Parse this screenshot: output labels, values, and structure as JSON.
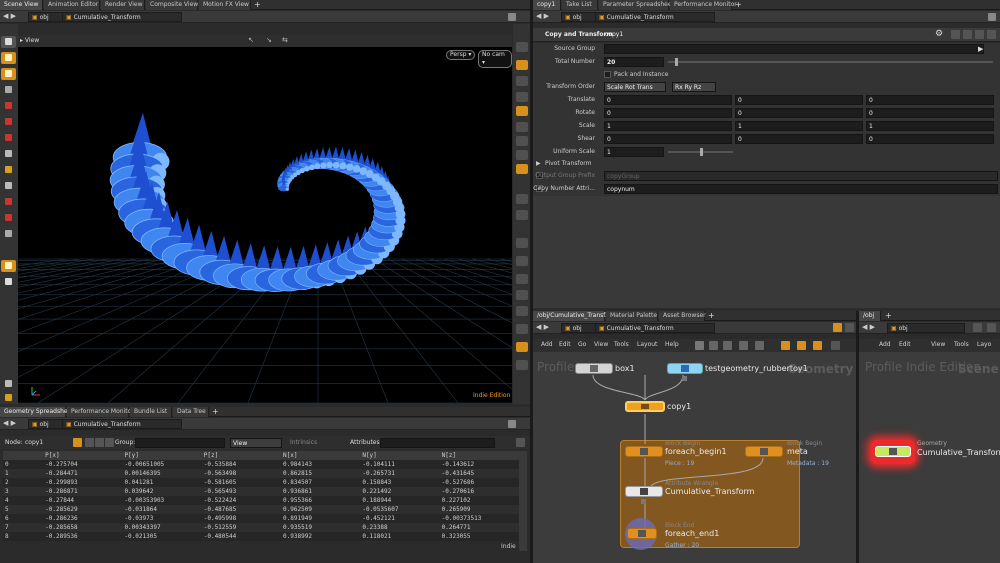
{
  "top_tabs": [
    "Scene View",
    "Animation Editor",
    "Render View",
    "Composite View",
    "Motion FX View"
  ],
  "scene_path": "obj",
  "scene_node": "Cumulative_Transform",
  "viewport": {
    "label": "View",
    "persp": "Persp ▾",
    "cam": "No cam ▾",
    "edition": "Indie Edition"
  },
  "bottom_tabs": [
    "Geometry Spreadsheet",
    "Performance Monitor",
    "Bundle List",
    "Data Tree"
  ],
  "spreadsheet": {
    "path": "obj",
    "node_path": "Cumulative_Transform",
    "node_label": "Node:",
    "node_value": "copy1",
    "group_label": "Group:",
    "view_label": "View",
    "intrinsics_label": "Intrinsics",
    "attributes_label": "Attributes:",
    "edition": "Indie",
    "columns": [
      "",
      "P[x]",
      "P[y]",
      "P[z]",
      "N[x]",
      "N[y]",
      "N[z]"
    ],
    "rows": [
      [
        "0",
        "-0.275704",
        "-0.00651005",
        "-0.535884",
        "0.984143",
        "-0.104111",
        "-0.143612"
      ],
      [
        "1",
        "-0.284471",
        "0.00146395",
        "-0.563498",
        "0.862815",
        "-0.265731",
        "-0.431645"
      ],
      [
        "2",
        "-0.299893",
        "0.041281",
        "-0.581605",
        "0.834507",
        "0.158843",
        "-0.527686"
      ],
      [
        "3",
        "-0.286871",
        "0.039642",
        "-0.565493",
        "0.936861",
        "0.221492",
        "-0.270616"
      ],
      [
        "4",
        "-0.27844",
        "-0.00353903",
        "-0.522424",
        "0.955366",
        "0.188944",
        "0.227102"
      ],
      [
        "5",
        "-0.285629",
        "-0.031864",
        "-0.487685",
        "0.962509",
        "-0.0535607",
        "0.265909"
      ],
      [
        "6",
        "-0.286236",
        "-0.03973",
        "-0.495998",
        "0.891949",
        "-0.452121",
        "-0.00373513"
      ],
      [
        "7",
        "-0.285658",
        "0.00343397",
        "-0.512559",
        "0.935519",
        "0.23388",
        "0.264771"
      ],
      [
        "8",
        "-0.289536",
        "-0.021305",
        "-0.480544",
        "0.938992",
        "0.118021",
        "0.323055"
      ]
    ]
  },
  "right_top_tabs": [
    "copy1",
    "Take List",
    "Parameter Spreadsheet",
    "Performance Monitor"
  ],
  "params": {
    "path": "obj",
    "node_path": "Cumulative_Transform",
    "header_label": "Copy and Transform",
    "header_value": "copy1",
    "source_group_label": "Source Group",
    "total_number_label": "Total Number",
    "total_number_value": "20",
    "total_number_fraction": 0.02,
    "pack_instance_label": "Pack and Instance",
    "transform_order_label": "Transform Order",
    "transform_order_value": "Scale Rot Trans",
    "rot_order_value": "Rx Ry Rz",
    "translate_label": "Translate",
    "translate": [
      "0",
      "0",
      "0"
    ],
    "rotate_label": "Rotate",
    "rotate": [
      "0",
      "0",
      "0"
    ],
    "scale_label": "Scale",
    "scale": [
      "1",
      "1",
      "1"
    ],
    "shear_label": "Shear",
    "shear": [
      "0",
      "0",
      "0"
    ],
    "uniform_scale_label": "Uniform Scale",
    "uniform_scale_value": "1",
    "pivot_label": "Pivot Transform",
    "output_group_label": "Output Group Prefix",
    "output_group_value": "copyGroup",
    "copy_number_label": "Copy Number Attri...",
    "copy_number_value": "copynum"
  },
  "network_left": {
    "tabs": [
      "/obj/Cumulative_Transf...",
      "Material Palette",
      "Asset Browser"
    ],
    "path": "obj",
    "node_path": "Cumulative_Transform",
    "menu": [
      "Add",
      "Edit",
      "Go",
      "View",
      "Tools",
      "Layout",
      "Help"
    ],
    "watermark_left": "Profile",
    "watermark_right": "Geometry",
    "nodes": {
      "box1": "box1",
      "rubbertoy": "testgeometry_rubbertoy1",
      "copy1": "copy1",
      "foreach_begin_type": "Block Begin",
      "foreach_begin": "foreach_begin1",
      "foreach_begin_sub": "Piece : 19",
      "meta_type": "Block Begin",
      "meta": "meta",
      "meta_sub": "Metadata : 19",
      "wrangle_type": "Attribute Wrangle",
      "wrangle": "Cumulative_Transform",
      "end_type": "Block End",
      "end": "foreach_end1",
      "end_sub": "Gather : 20"
    }
  },
  "network_right": {
    "tab": "/obj",
    "path": "obj",
    "menu": [
      "Add",
      "Edit",
      "View",
      "Tools",
      "Layo"
    ],
    "watermark_left": "Profile Indie Edition",
    "watermark_right": "Scene",
    "node_type": "Geometry",
    "node_name": "Cumulative_Transform"
  },
  "colors": {
    "accent": "#f0a020",
    "node_yellow": "#e8a020",
    "node_blue": "#7ec8f0",
    "selected_red": "#ff2a2a",
    "mesh_blue": "#2f6fe8"
  }
}
